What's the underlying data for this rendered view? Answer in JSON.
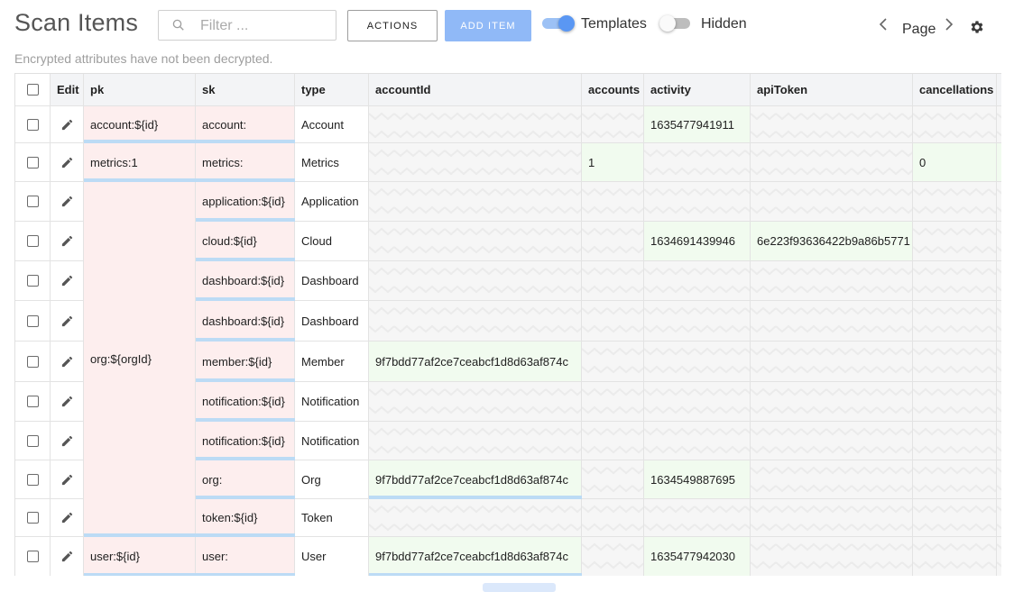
{
  "header": {
    "title": "Scan Items",
    "filter_placeholder": "Filter ...",
    "actions_label": "ACTIONS",
    "add_item_label": "ADD ITEM",
    "templates_label": "Templates",
    "templates_on": true,
    "hidden_label": "Hidden",
    "hidden_on": false,
    "page_label": "Page",
    "subtitle": "Encrypted attributes have not been decrypted."
  },
  "colors": {
    "accent": "#5a97f3",
    "key_cell": "#fdeeee",
    "value_cell": "#f1fbef",
    "underline": "#bcdbf5"
  },
  "columns": {
    "edit": "Edit",
    "pk": "pk",
    "sk": "sk",
    "type": "type",
    "accountId": "accountId",
    "accounts": "accounts",
    "activity": "activity",
    "apiToken": "apiToken",
    "cancellations": "cancellations"
  },
  "rows": [
    {
      "pk": "account:${id}",
      "sk": "account:",
      "type": "Account",
      "accountId": "",
      "accounts": "",
      "activity": "1635477941911",
      "apiToken": "",
      "cancellations": ""
    },
    {
      "pk": "metrics:1",
      "sk": "metrics:",
      "type": "Metrics",
      "accountId": "",
      "accounts": "1",
      "activity": "",
      "apiToken": "",
      "cancellations": "0"
    },
    {
      "pk": "org:${orgId}",
      "sk": "application:${id}",
      "type": "Application",
      "accountId": "",
      "accounts": "",
      "activity": "",
      "apiToken": "",
      "cancellations": ""
    },
    {
      "pk": "",
      "sk": "cloud:${id}",
      "type": "Cloud",
      "accountId": "",
      "accounts": "",
      "activity": "1634691439946",
      "apiToken": "6e223f93636422b9a86b5771",
      "cancellations": ""
    },
    {
      "pk": "",
      "sk": "dashboard:${id}",
      "type": "Dashboard",
      "accountId": "",
      "accounts": "",
      "activity": "",
      "apiToken": "",
      "cancellations": ""
    },
    {
      "pk": "",
      "sk": "dashboard:${id}",
      "type": "Dashboard",
      "accountId": "",
      "accounts": "",
      "activity": "",
      "apiToken": "",
      "cancellations": ""
    },
    {
      "pk": "",
      "sk": "member:${id}",
      "type": "Member",
      "accountId": "9f7bdd77af2ce7ceabcf1d8d63af874c",
      "accounts": "",
      "activity": "",
      "apiToken": "",
      "cancellations": ""
    },
    {
      "pk": "",
      "sk": "notification:${id}",
      "type": "Notification",
      "accountId": "",
      "accounts": "",
      "activity": "",
      "apiToken": "",
      "cancellations": ""
    },
    {
      "pk": "",
      "sk": "notification:${id}",
      "type": "Notification",
      "accountId": "",
      "accounts": "",
      "activity": "",
      "apiToken": "",
      "cancellations": ""
    },
    {
      "pk": "",
      "sk": "org:",
      "type": "Org",
      "accountId": "9f7bdd77af2ce7ceabcf1d8d63af874c",
      "accounts": "",
      "activity": "1634549887695",
      "apiToken": "",
      "cancellations": ""
    },
    {
      "pk": "",
      "sk": "token:${id}",
      "type": "Token",
      "accountId": "",
      "accounts": "",
      "activity": "",
      "apiToken": "",
      "cancellations": ""
    },
    {
      "pk": "user:${id}",
      "sk": "user:",
      "type": "User",
      "accountId": "9f7bdd77af2ce7ceabcf1d8d63af874c",
      "accounts": "",
      "activity": "1635477942030",
      "apiToken": "",
      "cancellations": ""
    }
  ]
}
